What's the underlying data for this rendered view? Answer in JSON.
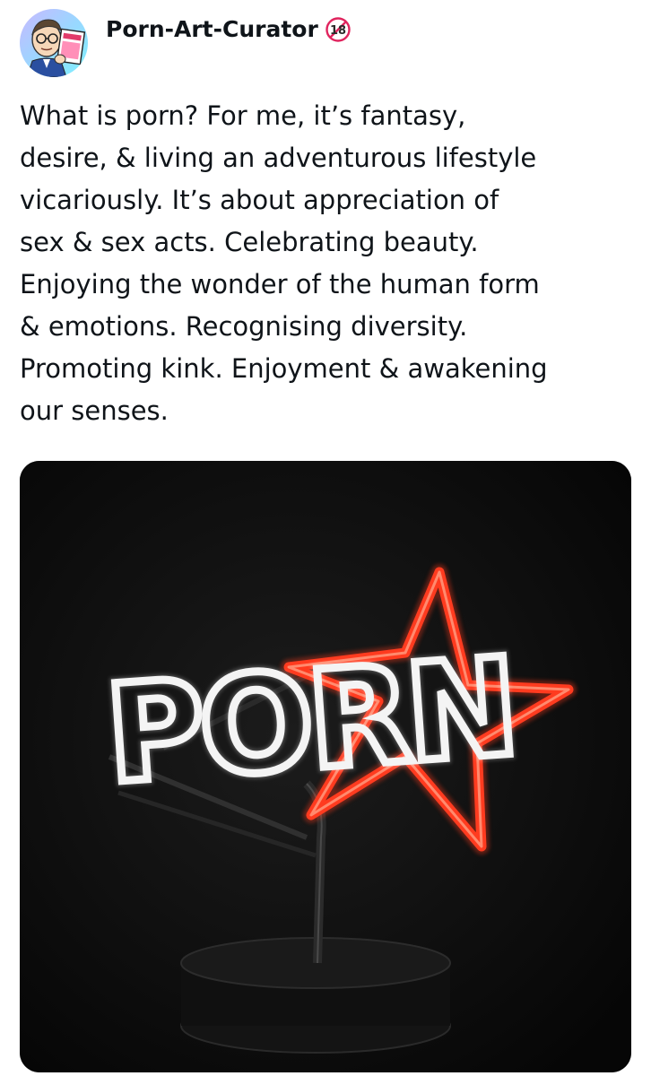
{
  "post": {
    "author": {
      "display_name": "Porn-Art-Curator",
      "badge_icon": "eighteen-plus-icon",
      "badge_text": "18"
    },
    "text_lines": [
      "What is porn? For me, it’s fantasy,",
      "desire, & living an adventurous lifestyle",
      "vicariously. It’s about appreciation of",
      "sex & sex acts. Celebrating beauty.",
      "Enjoying the wonder of the human form",
      "& emotions. Recognising diversity.",
      "Promoting kink. Enjoyment & awakening",
      "our senses."
    ],
    "media": {
      "neon_text": "PORN"
    }
  },
  "colors": {
    "text": "#0f1419",
    "neon_white": "#f4f4f4",
    "neon_red": "#ff3b1f",
    "media_background": "#0b0b0b",
    "badge_red": "#e0245e"
  }
}
